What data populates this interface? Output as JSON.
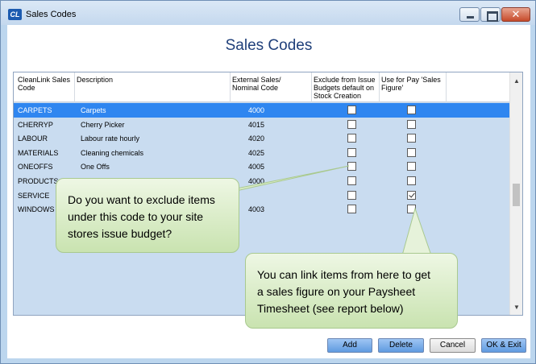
{
  "window": {
    "title": "Sales Codes",
    "app_icon": "CL",
    "close_glyph": "✕"
  },
  "heading": "Sales Codes",
  "table": {
    "headers": [
      "CleanLink Sales Code",
      "Description",
      "External Sales/ Nominal Code",
      "Exclude from Issue Budgets default on Stock Creation",
      "Use for Pay 'Sales Figure'"
    ],
    "rows": [
      {
        "code": "CARPETS",
        "description": "Carpets",
        "external": "4000",
        "exclude": false,
        "use_pay": false,
        "selected": true
      },
      {
        "code": "CHERRYP",
        "description": "Cherry Picker",
        "external": "4015",
        "exclude": false,
        "use_pay": false,
        "selected": false
      },
      {
        "code": "LABOUR",
        "description": "Labour rate hourly",
        "external": "4020",
        "exclude": false,
        "use_pay": false,
        "selected": false
      },
      {
        "code": "MATERIALS",
        "description": "Cleaning chemicals",
        "external": "4025",
        "exclude": false,
        "use_pay": false,
        "selected": false
      },
      {
        "code": "ONEOFFS",
        "description": "One Offs",
        "external": "4005",
        "exclude": false,
        "use_pay": false,
        "selected": false
      },
      {
        "code": "PRODUCTS",
        "description": "",
        "external": "4000",
        "exclude": false,
        "use_pay": false,
        "selected": false
      },
      {
        "code": "SERVICE",
        "description": "",
        "external": "",
        "exclude": false,
        "use_pay": true,
        "selected": false
      },
      {
        "code": "WINDOWS",
        "description": "",
        "external": "4003",
        "exclude": false,
        "use_pay": false,
        "selected": false
      }
    ]
  },
  "callouts": {
    "exclude": [
      "Do you want to exclude items",
      "under this code to your site",
      "stores issue budget?"
    ],
    "pay": [
      "You can link items from here to get",
      "a sales figure on your Paysheet",
      "Timesheet (see report below)"
    ]
  },
  "buttons": {
    "add": "Add",
    "delete": "Delete",
    "cancel": "Cancel",
    "ok": "OK & Exit"
  },
  "colors": {
    "selected_row": "#2f86f0",
    "grid_bg": "#c9dcf0",
    "heading": "#1f3f7a",
    "callout": "#d9ecc6"
  }
}
